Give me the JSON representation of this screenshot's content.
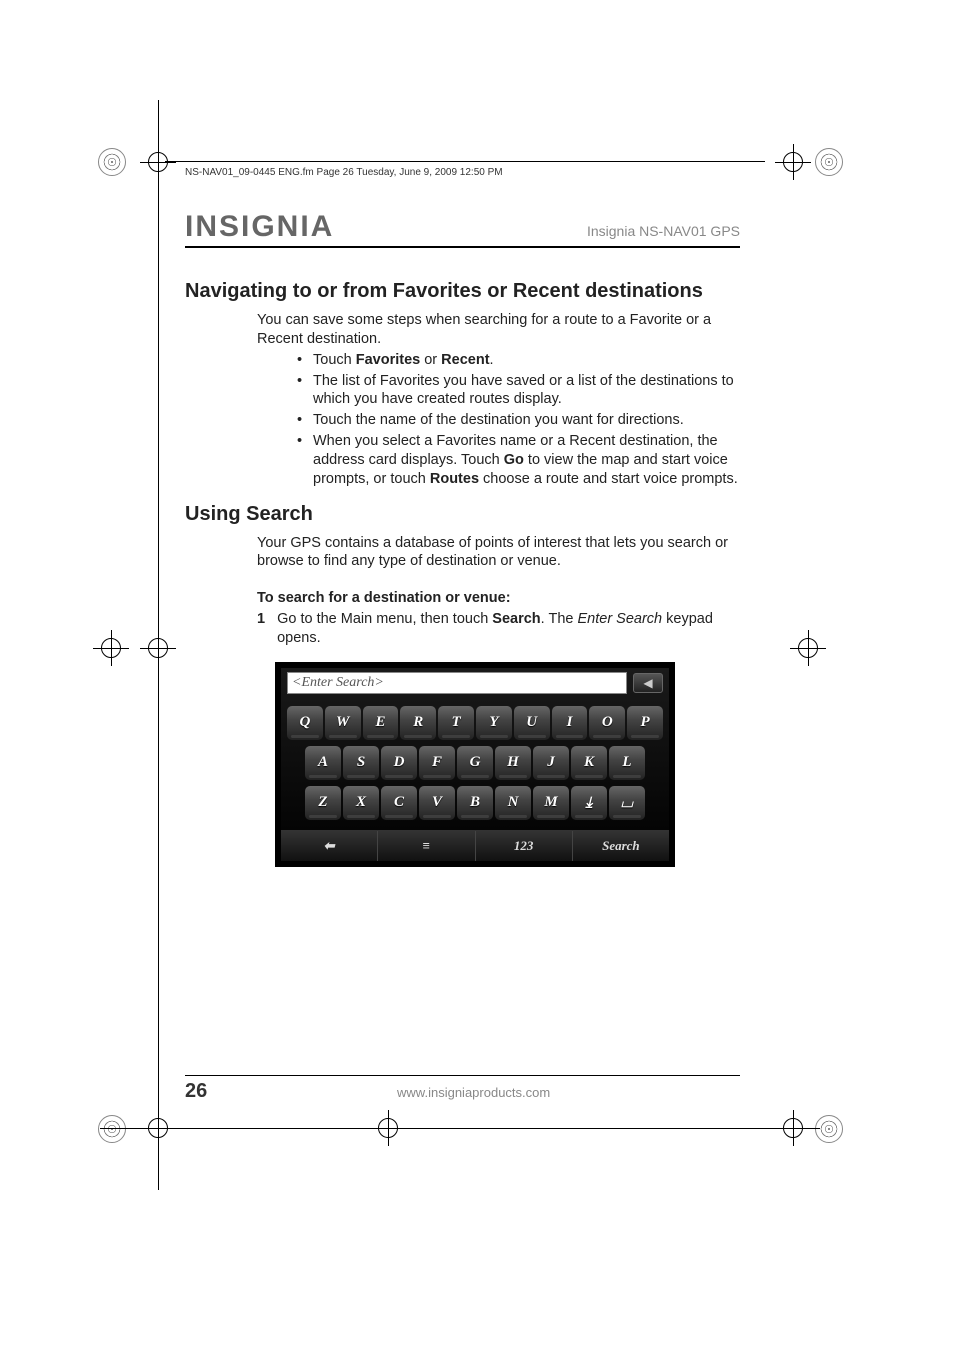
{
  "meta_header": "NS-NAV01_09-0445 ENG.fm  Page 26  Tuesday, June 9, 2009  12:50 PM",
  "brand": "INSIGNIA",
  "product": "Insignia NS-NAV01 GPS",
  "section1": {
    "title": "Navigating to or from Favorites or Recent destinations",
    "intro": "You can save some steps when searching for a route to a Favorite or a Recent destination.",
    "bullets": [
      {
        "pre": "Touch ",
        "b1": "Favorites",
        "mid": " or ",
        "b2": "Recent",
        "post": "."
      },
      {
        "text": "The list of Favorites you have saved or a list of the destinations to which you have created routes display."
      },
      {
        "text": "Touch the name of the destination you want for directions."
      },
      {
        "pre": "When you select a Favorites name or a Recent destination, the address card displays. Touch ",
        "b1": "Go",
        "mid": " to view the map and start voice prompts, or touch ",
        "b2": "Routes",
        "post": " choose a route and start voice prompts."
      }
    ]
  },
  "section2": {
    "title": "Using Search",
    "intro": "Your GPS contains a database of points of interest that lets you search or browse to find any type of destination or venue.",
    "subhead": "To search for a destination or venue:",
    "step1": {
      "num": "1",
      "pre": "Go to the Main menu, then touch ",
      "b1": "Search",
      "mid": ". The ",
      "i1": "Enter Search",
      "post": " keypad opens."
    }
  },
  "keypad": {
    "placeholder": "<Enter Search>",
    "back_icon": "◀",
    "row1": [
      "Q",
      "W",
      "E",
      "R",
      "T",
      "Y",
      "U",
      "I",
      "O",
      "P"
    ],
    "row2": [
      "A",
      "S",
      "D",
      "F",
      "G",
      "H",
      "J",
      "K",
      "L"
    ],
    "row3": [
      "Z",
      "X",
      "C",
      "V",
      "B",
      "N",
      "M"
    ],
    "shift": "⤓",
    "space": "␣",
    "bottom": {
      "back": "⬅",
      "list": "≡",
      "num": "123",
      "search": "Search"
    }
  },
  "footer": {
    "page": "26",
    "url": "www.insigniaproducts.com"
  }
}
